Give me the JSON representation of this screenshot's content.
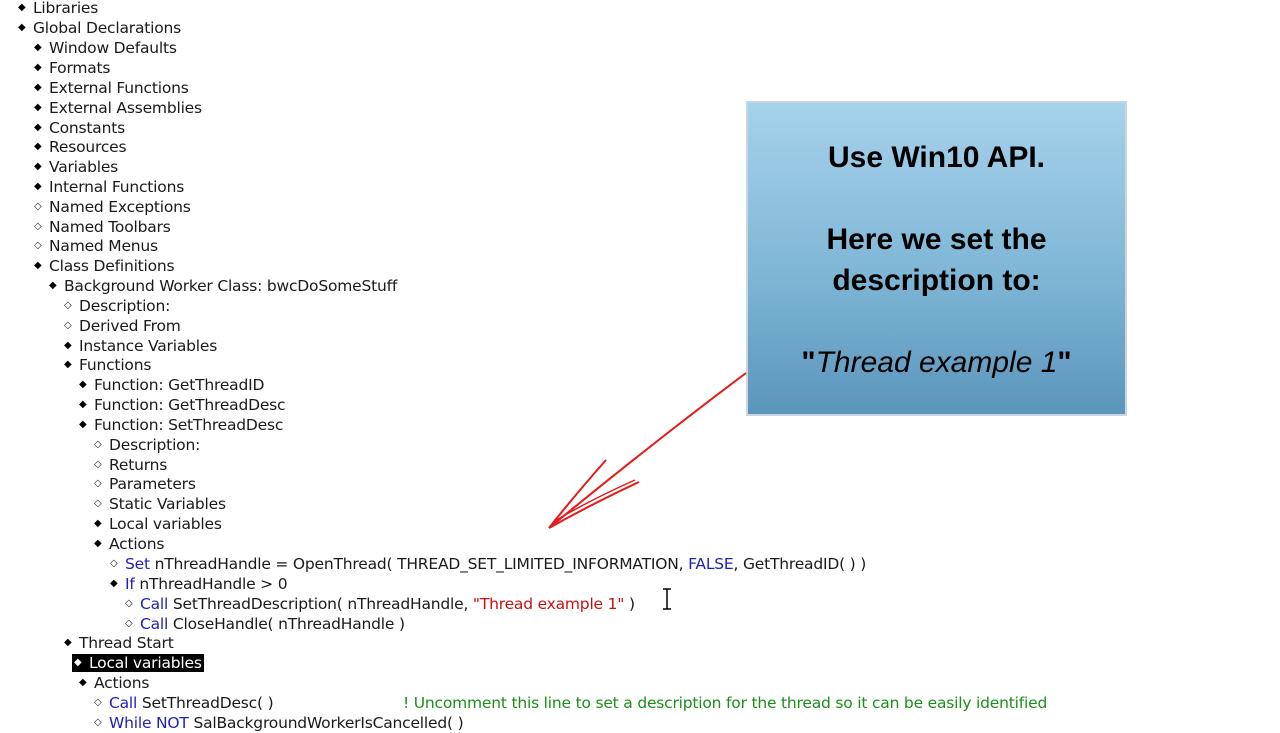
{
  "tree": [
    {
      "label": "Libraries",
      "bullet": "filled"
    },
    {
      "label": "Global Declarations",
      "bullet": "filled"
    },
    {
      "label": "Window Defaults",
      "bullet": "filled"
    },
    {
      "label": "Formats",
      "bullet": "filled"
    },
    {
      "label": "External Functions",
      "bullet": "filled"
    },
    {
      "label": "External Assemblies",
      "bullet": "filled"
    },
    {
      "label": "Constants",
      "bullet": "filled"
    },
    {
      "label": "Resources",
      "bullet": "filled"
    },
    {
      "label": "Variables",
      "bullet": "filled"
    },
    {
      "label": "Internal Functions",
      "bullet": "filled"
    },
    {
      "label": "Named Exceptions",
      "bullet": "hollow"
    },
    {
      "label": "Named Toolbars",
      "bullet": "hollow"
    },
    {
      "label": "Named Menus",
      "bullet": "hollow"
    },
    {
      "label": "Class Definitions",
      "bullet": "filled"
    },
    {
      "label": "Background Worker Class: bwcDoSomeStuff",
      "bullet": "filled"
    },
    {
      "label": "Description:",
      "bullet": "hollow"
    },
    {
      "label": "Derived From",
      "bullet": "hollow"
    },
    {
      "label": "Instance Variables",
      "bullet": "filled"
    },
    {
      "label": "Functions",
      "bullet": "filled"
    },
    {
      "label": "Function: GetThreadID",
      "bullet": "filled"
    },
    {
      "label": "Function: GetThreadDesc",
      "bullet": "filled"
    },
    {
      "label": "Function: SetThreadDesc",
      "bullet": "filled"
    },
    {
      "label": "Description:",
      "bullet": "hollow"
    },
    {
      "label": "Returns",
      "bullet": "hollow"
    },
    {
      "label": "Parameters",
      "bullet": "hollow"
    },
    {
      "label": "Static Variables",
      "bullet": "hollow"
    },
    {
      "label": "Local variables",
      "bullet": "filled"
    },
    {
      "label": "Actions",
      "bullet": "filled"
    }
  ],
  "code": {
    "set_kw": "Set",
    "set_text_1": "nThreadHandle = OpenThread( THREAD_SET_LIMITED_INFORMATION,",
    "set_false": "FALSE",
    "set_text_2": ", GetThreadID( ) )",
    "if_kw": "If",
    "if_text": "nThreadHandle > 0",
    "call_kw": "Call",
    "call1_text_1": "SetThreadDescription( nThreadHandle,",
    "call1_str": "\"Thread example 1\"",
    "call1_text_2": ")",
    "call2_text": "CloseHandle( nThreadHandle )",
    "thread_start": "Thread Start",
    "local_variables": "Local variables",
    "actions": "Actions",
    "call3_text": "SetThreadDesc( )",
    "comment": "! Uncomment this line to set a description for the thread so it can be easily identified",
    "while_kw": "While NOT",
    "while_text": "SalBackgroundWorkerIsCancelled( )"
  },
  "callout": {
    "line1": "Use Win10 API.",
    "line2": "Here we set the",
    "line3": "description to:",
    "quote_open": "\"",
    "quote_text": "Thread example 1",
    "quote_close": "\""
  },
  "colors": {
    "keyword": "#1f1fb8",
    "string": "#cc1010",
    "comment": "#1a8f1a",
    "arrow": "#e31b1b"
  },
  "icons": {
    "arrow": "red-arrow-icon",
    "cursor": "text-cursor-icon"
  }
}
